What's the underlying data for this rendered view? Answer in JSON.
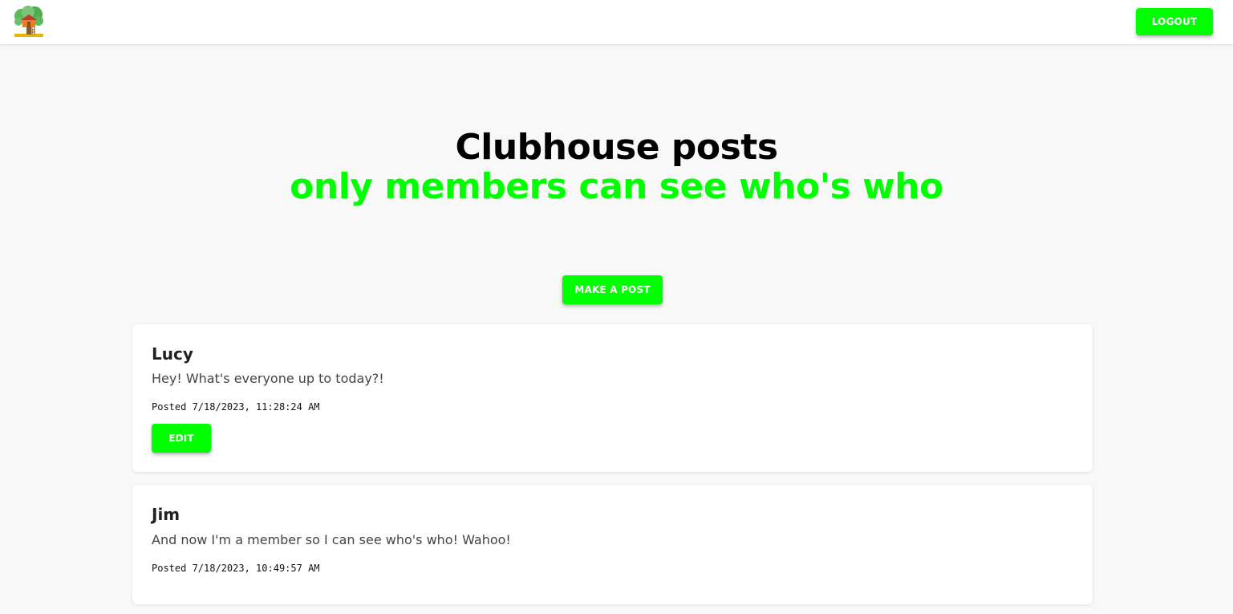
{
  "header": {
    "logo_icon": "treehouse-icon",
    "logout_label": "LOGOUT"
  },
  "hero": {
    "title": "Clubhouse posts",
    "subtitle": "only members can see who's who"
  },
  "actions": {
    "make_post_label": "MAKE A POST"
  },
  "posts": [
    {
      "author": "Lucy",
      "body": "Hey! What's everyone up to today?!",
      "date": "Posted 7/18/2023, 11:28:24 AM",
      "edit_label": "EDIT"
    },
    {
      "author": "Jim",
      "body": "And now I'm a member so I can see who's who! Wahoo!",
      "date": "Posted 7/18/2023, 10:49:57 AM"
    }
  ],
  "colors": {
    "accent": "#00ff00",
    "background": "#f8f8f8",
    "card": "#ffffff"
  }
}
